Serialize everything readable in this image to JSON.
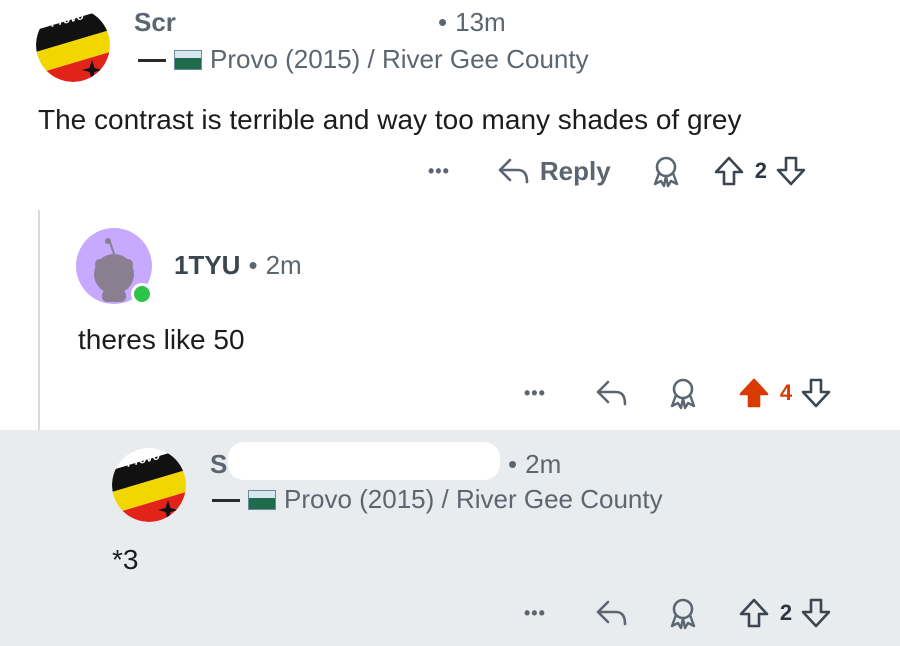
{
  "comments": [
    {
      "username_visible": "Scr",
      "time": "13m",
      "flair_text": "Provo (2015) / River Gee County",
      "body": "The contrast is terrible and way too many shades of grey",
      "actions": {
        "more": "•••",
        "reply_label": "Reply",
        "score": "2"
      }
    },
    {
      "username": "1TYU",
      "time": "2m",
      "body": "theres like 50",
      "actions": {
        "more": "•••",
        "score": "4"
      }
    },
    {
      "username_visible": "S",
      "time": "2m",
      "flair_text": "Provo (2015) / River Gee County",
      "body": "*3",
      "actions": {
        "more": "•••",
        "score": "2"
      }
    }
  ],
  "logo_text": "Provo",
  "colors": {
    "upvoted": "#d93a00",
    "meta": "#5c6670",
    "highlight_bg": "#e9ecef",
    "online": "#2ec44a"
  }
}
